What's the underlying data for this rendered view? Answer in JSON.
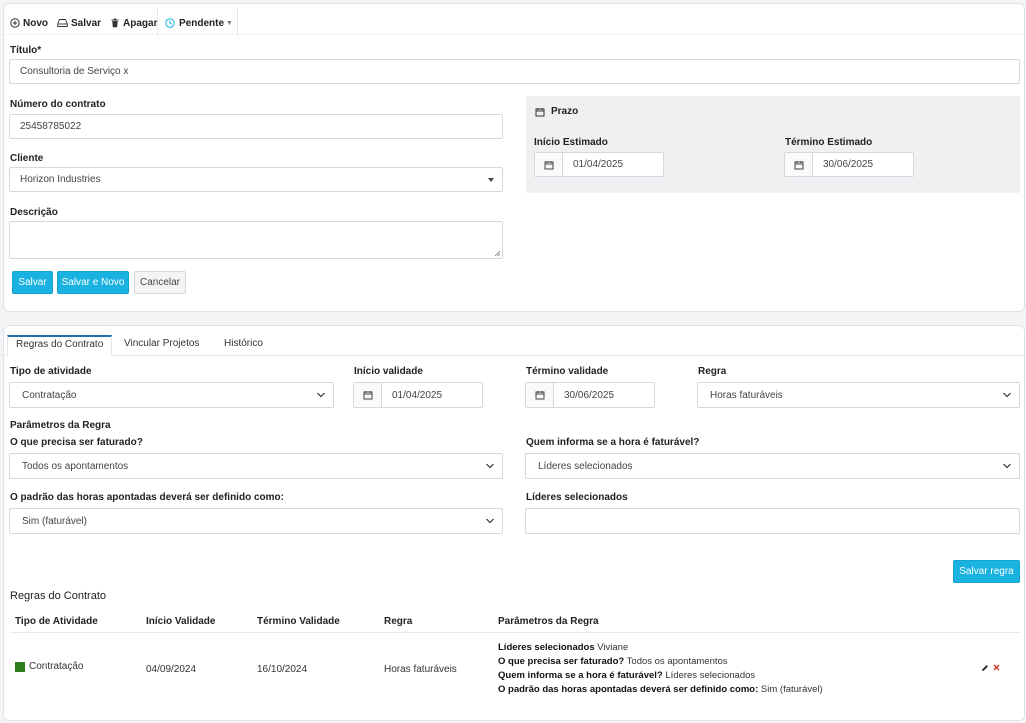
{
  "toolbar": {
    "new_label": "Novo",
    "save_label": "Salvar",
    "delete_label": "Apagar",
    "status_label": "Pendente"
  },
  "form": {
    "title_label": "Título*",
    "title_value": "Consultoria de Serviço x",
    "contract_number_label": "Número do contrato",
    "contract_number_value": "25458785022",
    "client_label": "Cliente",
    "client_value": "Horizon Industries",
    "description_label": "Descrição",
    "description_value": "",
    "prazo": {
      "title": "Prazo",
      "start_label": "Início Estimado",
      "start_value": "01/04/2025",
      "end_label": "Término Estimado",
      "end_value": "30/06/2025"
    },
    "buttons": {
      "save": "Salvar",
      "save_and_new": "Salvar e Novo",
      "cancel": "Cancelar"
    }
  },
  "tabs": [
    {
      "label": "Regras do Contrato",
      "active": true
    },
    {
      "label": "Vincular Projetos",
      "active": false
    },
    {
      "label": "Histórico",
      "active": false
    }
  ],
  "rule_form": {
    "activity_type_label": "Tipo de atividade",
    "activity_type_value": "Contratação",
    "start_label": "Início validade",
    "start_value": "01/04/2025",
    "end_label": "Término validade",
    "end_value": "30/06/2025",
    "rule_label": "Regra",
    "rule_value": "Horas faturáveis",
    "params_title": "Parâmetros da Regra",
    "what_billed_label": "O que precisa ser faturado?",
    "what_billed_value": "Todos os apontamentos",
    "who_informs_label": "Quem informa se a hora é faturável?",
    "who_informs_value": "Líderes selecionados",
    "default_hours_label": "O padrão das horas apontadas deverá ser definido como:",
    "default_hours_value": "Sim (faturável)",
    "leaders_label": "Líderes selecionados",
    "leaders_value": "",
    "save_rule_button": "Salvar regra"
  },
  "rules_table": {
    "title": "Regras do Contrato",
    "columns": [
      "Tipo de Atividade",
      "Início Validade",
      "Término Validade",
      "Regra",
      "Parâmetros da Regra"
    ],
    "rows": [
      {
        "activity_type": "Contratação",
        "activity_color": "#2e7d1f",
        "start": "04/09/2024",
        "end": "16/10/2024",
        "rule": "Horas faturáveis",
        "params": [
          {
            "label": "Líderes selecionados",
            "value": "Viviane"
          },
          {
            "label": "O que precisa ser faturado?",
            "value": "Todos os apontamentos"
          },
          {
            "label": "Quem informa se a hora é faturável?",
            "value": "Líderes selecionados"
          },
          {
            "label": "O padrão das horas apontadas deverá ser definido como:",
            "value": "Sim (faturável)"
          }
        ]
      }
    ]
  },
  "colors": {
    "primary": "#1ab2e0",
    "tab_active_border": "#1a6fb5",
    "delete_icon": "#d9342b",
    "prazo_background": "#eef0f2"
  }
}
